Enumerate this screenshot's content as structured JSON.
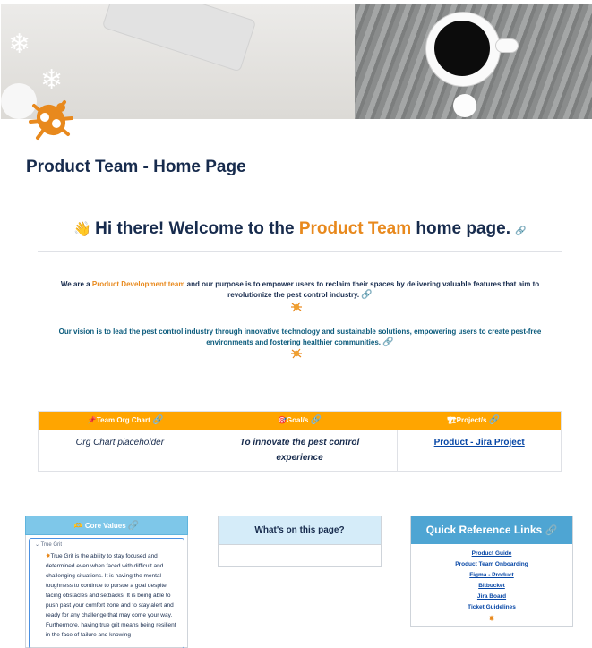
{
  "page": {
    "title": "Product Team - Home Page"
  },
  "welcome": {
    "prefix": "Hi there! Welcome to the",
    "highlight": "Product Team",
    "suffix": "home page."
  },
  "intro": {
    "purpose_pre": "We are a",
    "purpose_hl": "Product Development team",
    "purpose_post": "and our purpose is to empower users to reclaim their spaces by delivering valuable features that aim to revolutionize the pest control industry.",
    "vision": "Our vision is to lead the pest control industry through innovative technology and sustainable solutions, empowering users to create pest-free environments and fostering healthier communities."
  },
  "table": {
    "headers": [
      "📌Team Org Chart",
      "🎯Goal/s",
      "🏗Project/s"
    ],
    "org_chart": "Org Chart placeholder",
    "goal": "To innovate the pest control experience",
    "project": "Product - Jira Project"
  },
  "core_values": {
    "title": "Core Values",
    "title_emoji": "🫶",
    "expand_title": "True Grit",
    "text": "True Grit is the ability to stay focused and determined even when faced with difficult and challenging situations. It is having the mental toughness to continue to pursue a goal despite facing obstacles and setbacks. It is being able to push past your comfort zone and to stay alert and ready for any challenge that may come your way. Furthermore, having true grit means being resilient in the face of failure and knowing"
  },
  "toc": {
    "title": "What's on this page?"
  },
  "quick_links": {
    "title": "Quick Reference Links",
    "items": [
      "Product Guide",
      "Product Team Onboarding",
      "Figma - Product",
      "Bitbucket",
      "Jira Board",
      "Ticket Guidelines"
    ]
  },
  "colors": {
    "accent": "#e8891d",
    "table_header": "#ffa500",
    "vision": "#0b5b7c",
    "link": "#0747a6"
  }
}
